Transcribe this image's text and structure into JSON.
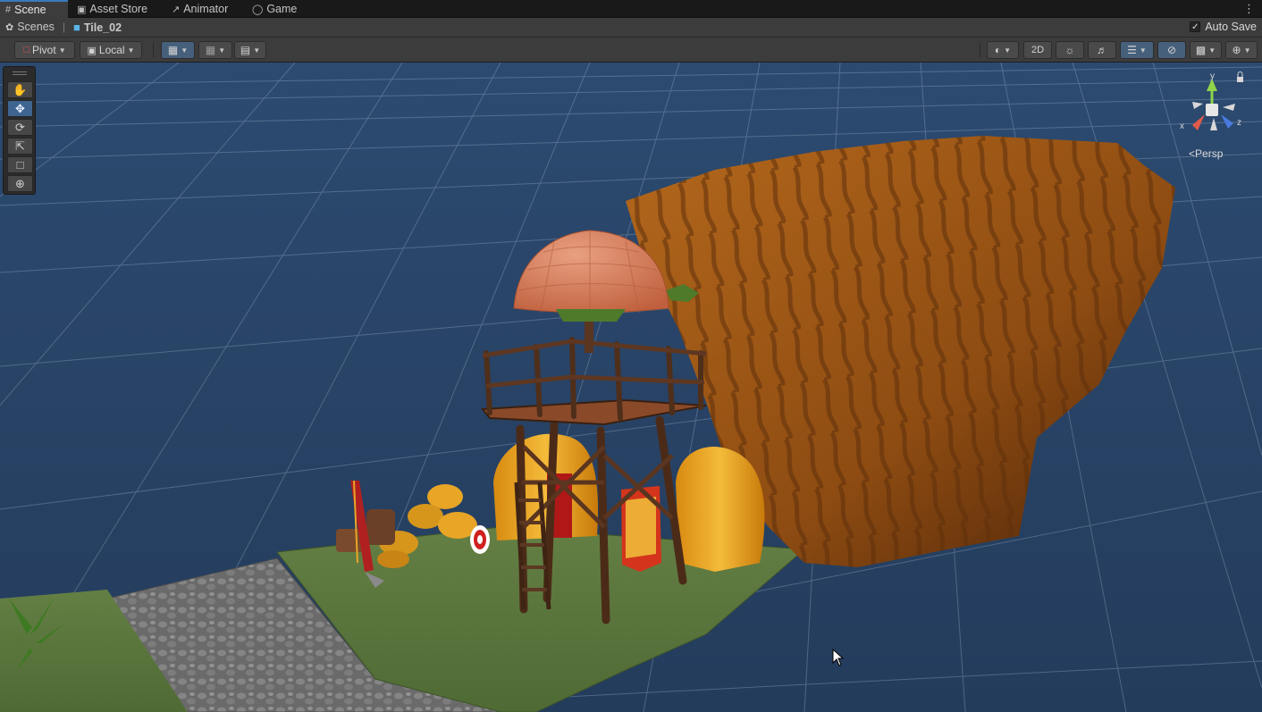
{
  "tabs": [
    {
      "label": "Scene",
      "icon": "grid-icon",
      "active": true
    },
    {
      "label": "Asset Store",
      "icon": "shopping-bag-icon",
      "active": false
    },
    {
      "label": "Animator",
      "icon": "animator-icon",
      "active": false
    },
    {
      "label": "Game",
      "icon": "gamepad-icon",
      "active": false
    }
  ],
  "breadcrumb": {
    "root": "Scenes",
    "current": "Tile_02"
  },
  "autosave": {
    "label": "Auto Save",
    "checked": true
  },
  "toolbar": {
    "pivot": "Pivot",
    "local": "Local",
    "mode_2d": "2D"
  },
  "gizmo": {
    "x": "x",
    "y": "y",
    "z": "z",
    "projection": "Persp"
  },
  "colors": {
    "sky": "#2a4466",
    "accent": "#3a79bb",
    "cliff": "#a35a14",
    "grass": "#5a7a3a",
    "stone": "#6e6e6e",
    "roof": "#d77e58",
    "wood": "#4e2e1c",
    "hay": "#e8a526"
  }
}
